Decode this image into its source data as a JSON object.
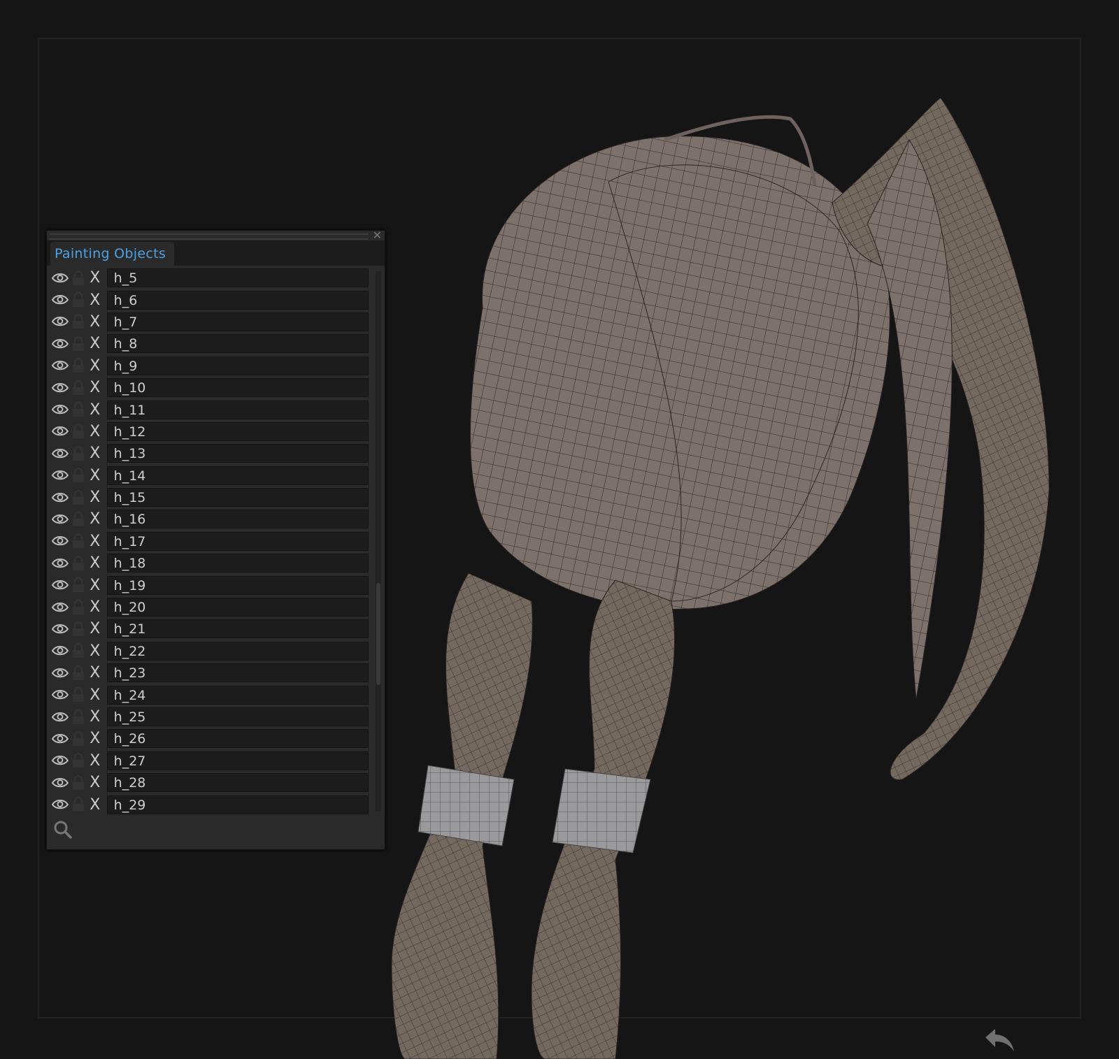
{
  "panel": {
    "tab_label": "Painting  Objects",
    "close_label": "✕",
    "objects": [
      "h_5",
      "h_6",
      "h_7",
      "h_8",
      "h_9",
      "h_10",
      "h_11",
      "h_12",
      "h_13",
      "h_14",
      "h_15",
      "h_16",
      "h_17",
      "h_18",
      "h_19",
      "h_20",
      "h_21",
      "h_22",
      "h_23",
      "h_24",
      "h_25",
      "h_26",
      "h_27",
      "h_28",
      "h_29",
      ""
    ],
    "delete_glyph": "X"
  },
  "colors": {
    "accent": "#4fa0e0",
    "mesh": "#7d716c",
    "background": "#151515"
  }
}
